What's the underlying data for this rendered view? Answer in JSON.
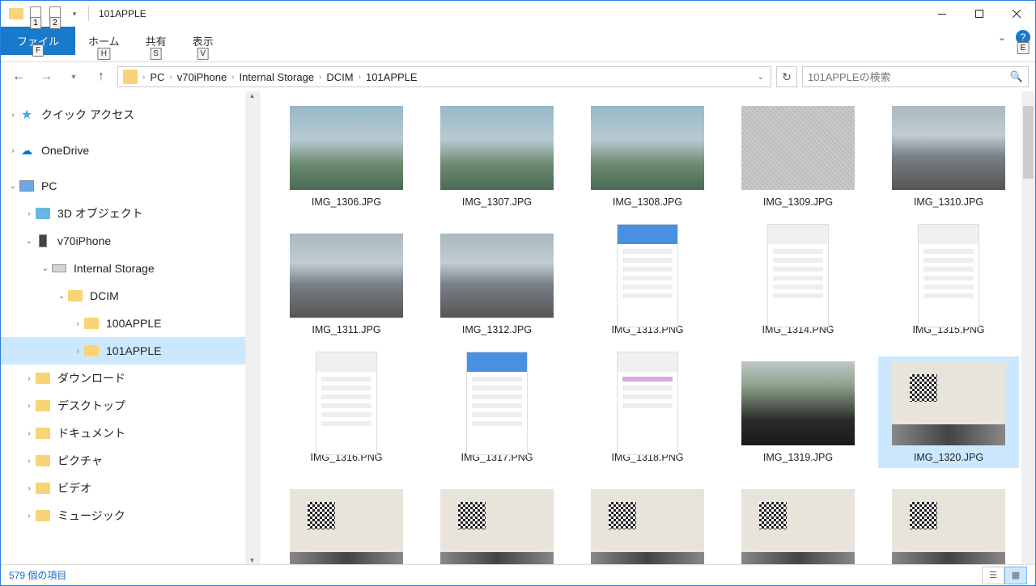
{
  "window": {
    "title": "101APPLE"
  },
  "ribbon": {
    "file": "ファイル",
    "home": "ホーム",
    "share": "共有",
    "view": "表示",
    "keytips": {
      "file": "F",
      "home": "H",
      "share": "S",
      "view": "V",
      "qat1": "1",
      "qat2": "2",
      "help": "E"
    }
  },
  "breadcrumb": [
    "PC",
    "v70iPhone",
    "Internal Storage",
    "DCIM",
    "101APPLE"
  ],
  "search": {
    "placeholder": "101APPLEの検索"
  },
  "tree": {
    "quick_access": "クイック アクセス",
    "onedrive": "OneDrive",
    "pc": "PC",
    "objects3d": "3D オブジェクト",
    "device": "v70iPhone",
    "internal": "Internal Storage",
    "dcim": "DCIM",
    "f100": "100APPLE",
    "f101": "101APPLE",
    "downloads": "ダウンロード",
    "desktop": "デスクトップ",
    "documents": "ドキュメント",
    "pictures": "ピクチャ",
    "videos": "ビデオ",
    "music": "ミュージック"
  },
  "files": [
    {
      "name": "IMG_1306.JPG",
      "kind": "photo"
    },
    {
      "name": "IMG_1307.JPG",
      "kind": "photo"
    },
    {
      "name": "IMG_1308.JPG",
      "kind": "photo"
    },
    {
      "name": "IMG_1309.JPG",
      "kind": "texture"
    },
    {
      "name": "IMG_1310.JPG",
      "kind": "road"
    },
    {
      "name": "IMG_1311.JPG",
      "kind": "road"
    },
    {
      "name": "IMG_1312.JPG",
      "kind": "road"
    },
    {
      "name": "IMG_1313.PNG",
      "kind": "screen"
    },
    {
      "name": "IMG_1314.PNG",
      "kind": "screen-light"
    },
    {
      "name": "IMG_1315.PNG",
      "kind": "screen-light"
    },
    {
      "name": "IMG_1316.PNG",
      "kind": "screen-light"
    },
    {
      "name": "IMG_1317.PNG",
      "kind": "screen"
    },
    {
      "name": "IMG_1318.PNG",
      "kind": "screen-purple"
    },
    {
      "name": "IMG_1319.JPG",
      "kind": "dash"
    },
    {
      "name": "IMG_1320.JPG",
      "kind": "qr",
      "selected": true
    },
    {
      "name": "",
      "kind": "qr"
    },
    {
      "name": "",
      "kind": "qr"
    },
    {
      "name": "",
      "kind": "qr"
    },
    {
      "name": "",
      "kind": "qr"
    },
    {
      "name": "",
      "kind": "qr"
    }
  ],
  "status": {
    "count": "579 個の項目"
  }
}
